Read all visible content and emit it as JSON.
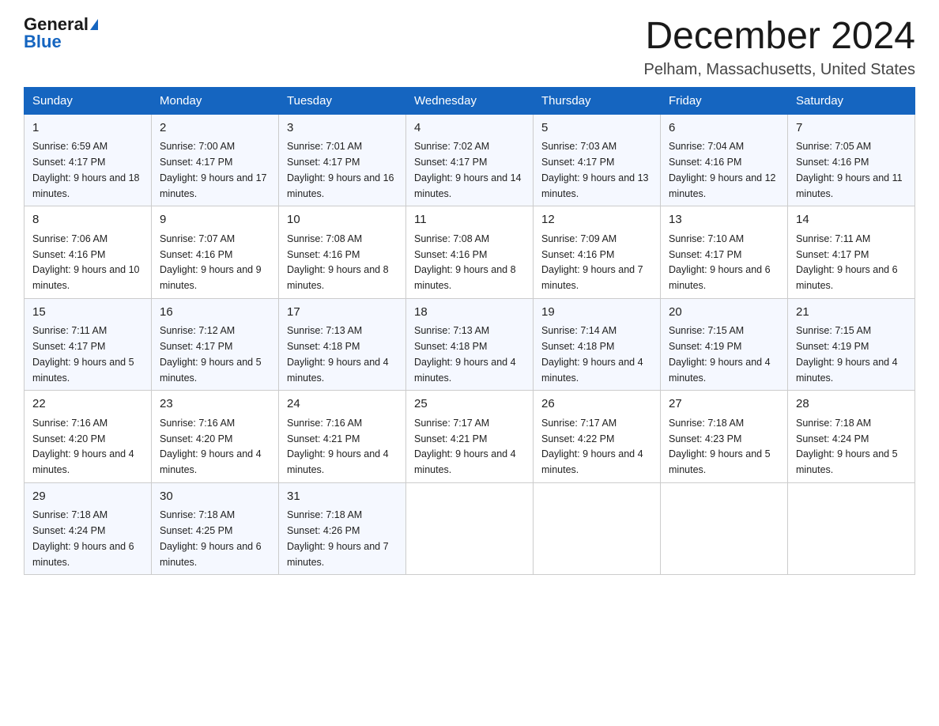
{
  "header": {
    "logo_general": "General",
    "logo_blue": "Blue",
    "month": "December 2024",
    "location": "Pelham, Massachusetts, United States"
  },
  "weekdays": [
    "Sunday",
    "Monday",
    "Tuesday",
    "Wednesday",
    "Thursday",
    "Friday",
    "Saturday"
  ],
  "weeks": [
    [
      {
        "day": "1",
        "sunrise": "6:59 AM",
        "sunset": "4:17 PM",
        "daylight": "9 hours and 18 minutes."
      },
      {
        "day": "2",
        "sunrise": "7:00 AM",
        "sunset": "4:17 PM",
        "daylight": "9 hours and 17 minutes."
      },
      {
        "day": "3",
        "sunrise": "7:01 AM",
        "sunset": "4:17 PM",
        "daylight": "9 hours and 16 minutes."
      },
      {
        "day": "4",
        "sunrise": "7:02 AM",
        "sunset": "4:17 PM",
        "daylight": "9 hours and 14 minutes."
      },
      {
        "day": "5",
        "sunrise": "7:03 AM",
        "sunset": "4:17 PM",
        "daylight": "9 hours and 13 minutes."
      },
      {
        "day": "6",
        "sunrise": "7:04 AM",
        "sunset": "4:16 PM",
        "daylight": "9 hours and 12 minutes."
      },
      {
        "day": "7",
        "sunrise": "7:05 AM",
        "sunset": "4:16 PM",
        "daylight": "9 hours and 11 minutes."
      }
    ],
    [
      {
        "day": "8",
        "sunrise": "7:06 AM",
        "sunset": "4:16 PM",
        "daylight": "9 hours and 10 minutes."
      },
      {
        "day": "9",
        "sunrise": "7:07 AM",
        "sunset": "4:16 PM",
        "daylight": "9 hours and 9 minutes."
      },
      {
        "day": "10",
        "sunrise": "7:08 AM",
        "sunset": "4:16 PM",
        "daylight": "9 hours and 8 minutes."
      },
      {
        "day": "11",
        "sunrise": "7:08 AM",
        "sunset": "4:16 PM",
        "daylight": "9 hours and 8 minutes."
      },
      {
        "day": "12",
        "sunrise": "7:09 AM",
        "sunset": "4:16 PM",
        "daylight": "9 hours and 7 minutes."
      },
      {
        "day": "13",
        "sunrise": "7:10 AM",
        "sunset": "4:17 PM",
        "daylight": "9 hours and 6 minutes."
      },
      {
        "day": "14",
        "sunrise": "7:11 AM",
        "sunset": "4:17 PM",
        "daylight": "9 hours and 6 minutes."
      }
    ],
    [
      {
        "day": "15",
        "sunrise": "7:11 AM",
        "sunset": "4:17 PM",
        "daylight": "9 hours and 5 minutes."
      },
      {
        "day": "16",
        "sunrise": "7:12 AM",
        "sunset": "4:17 PM",
        "daylight": "9 hours and 5 minutes."
      },
      {
        "day": "17",
        "sunrise": "7:13 AM",
        "sunset": "4:18 PM",
        "daylight": "9 hours and 4 minutes."
      },
      {
        "day": "18",
        "sunrise": "7:13 AM",
        "sunset": "4:18 PM",
        "daylight": "9 hours and 4 minutes."
      },
      {
        "day": "19",
        "sunrise": "7:14 AM",
        "sunset": "4:18 PM",
        "daylight": "9 hours and 4 minutes."
      },
      {
        "day": "20",
        "sunrise": "7:15 AM",
        "sunset": "4:19 PM",
        "daylight": "9 hours and 4 minutes."
      },
      {
        "day": "21",
        "sunrise": "7:15 AM",
        "sunset": "4:19 PM",
        "daylight": "9 hours and 4 minutes."
      }
    ],
    [
      {
        "day": "22",
        "sunrise": "7:16 AM",
        "sunset": "4:20 PM",
        "daylight": "9 hours and 4 minutes."
      },
      {
        "day": "23",
        "sunrise": "7:16 AM",
        "sunset": "4:20 PM",
        "daylight": "9 hours and 4 minutes."
      },
      {
        "day": "24",
        "sunrise": "7:16 AM",
        "sunset": "4:21 PM",
        "daylight": "9 hours and 4 minutes."
      },
      {
        "day": "25",
        "sunrise": "7:17 AM",
        "sunset": "4:21 PM",
        "daylight": "9 hours and 4 minutes."
      },
      {
        "day": "26",
        "sunrise": "7:17 AM",
        "sunset": "4:22 PM",
        "daylight": "9 hours and 4 minutes."
      },
      {
        "day": "27",
        "sunrise": "7:18 AM",
        "sunset": "4:23 PM",
        "daylight": "9 hours and 5 minutes."
      },
      {
        "day": "28",
        "sunrise": "7:18 AM",
        "sunset": "4:24 PM",
        "daylight": "9 hours and 5 minutes."
      }
    ],
    [
      {
        "day": "29",
        "sunrise": "7:18 AM",
        "sunset": "4:24 PM",
        "daylight": "9 hours and 6 minutes."
      },
      {
        "day": "30",
        "sunrise": "7:18 AM",
        "sunset": "4:25 PM",
        "daylight": "9 hours and 6 minutes."
      },
      {
        "day": "31",
        "sunrise": "7:18 AM",
        "sunset": "4:26 PM",
        "daylight": "9 hours and 7 minutes."
      },
      null,
      null,
      null,
      null
    ]
  ]
}
